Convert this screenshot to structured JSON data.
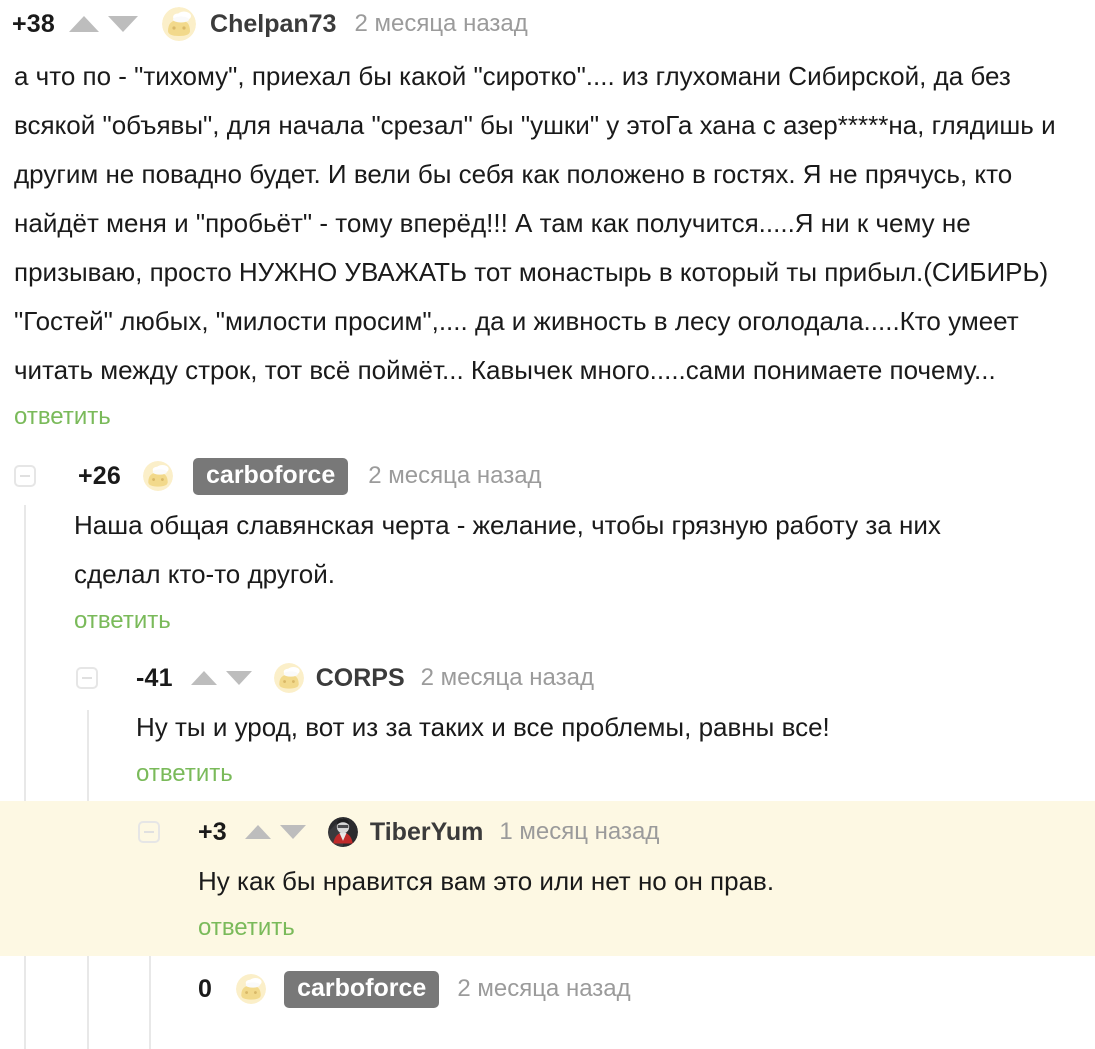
{
  "page": {
    "background": "#ffffff",
    "highlight_background": "#fdf8e3",
    "reply_link_color": "#7aba5a",
    "badge_background": "#787878",
    "arrow_color": "#bdbdbd"
  },
  "reply_label": "ответить",
  "comments": [
    {
      "id": "chelpan73",
      "score": "+38",
      "username": "Chelpan73",
      "time": "2 месяца назад",
      "avatar": "cheese-chef-avatar",
      "has_votes": true,
      "has_badge": false,
      "text": "а что по - \"тихому\", приехал бы какой \"сиротко\".... из глухомани Сибирской, да без всякой \"объявы\", для начала \"срезал\" бы \"ушки\" у этоГа хана с азер*****на, глядишь и другим не повадно будет. И вели бы себя как положено в гостях. Я не прячусь, кто найдёт меня и \"пробьёт\" - тому вперёд!!! А там как получится.....Я ни к чему не призываю, просто НУЖНО УВАЖАТЬ тот монастырь в который ты прибыл.(СИБИРЬ) \"Гостей\" любых, \"милости просим\",.... да и живность в лесу оголодала.....Кто умеет читать между строк, тот всё поймёт... Кавычек много.....сами понимаете почему..."
    },
    {
      "id": "carboforce-1",
      "score": "+26",
      "username": "carboforce",
      "time": "2 месяца назад",
      "avatar": "cheese-chef-avatar",
      "has_votes": false,
      "has_badge": true,
      "text": "Наша общая славянская черта - желание, чтобы грязную работу за них сделал кто-то другой."
    },
    {
      "id": "corps",
      "score": "-41",
      "username": "CORPS",
      "time": "2 месяца назад",
      "avatar": "cheese-chef-avatar",
      "has_votes": true,
      "has_badge": false,
      "text": "Ну ты и урод, вот из за таких и все проблемы, равны все!"
    },
    {
      "id": "tiberyum",
      "score": "+3",
      "username": "TiberYum",
      "time": "1 месяц назад",
      "avatar": "dark-red-avatar",
      "has_votes": true,
      "has_badge": false,
      "highlighted": true,
      "text": "Ну как бы нравится вам это или нет но он прав."
    },
    {
      "id": "carboforce-2",
      "score": "0",
      "username": "carboforce",
      "time": "2 месяца назад",
      "avatar": "cheese-chef-avatar",
      "has_votes": false,
      "has_badge": true,
      "text": ""
    }
  ]
}
